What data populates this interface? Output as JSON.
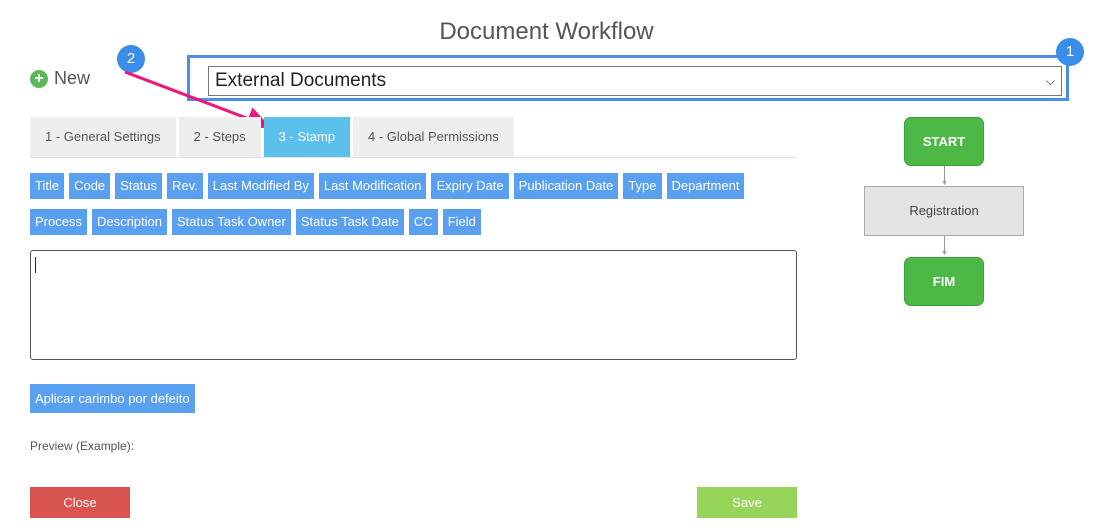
{
  "header": {
    "title": "Document Workflow"
  },
  "toolbar": {
    "new_label": "New"
  },
  "workflow_select": {
    "value": "External Documents"
  },
  "annotations": {
    "badge1": "1",
    "badge2": "2",
    "arrow_color": "#f0157a",
    "badge_color": "#3b8ee8"
  },
  "tabs": [
    {
      "label": "1 - General Settings",
      "active": false
    },
    {
      "label": "2 - Steps",
      "active": false
    },
    {
      "label": "3 - Stamp",
      "active": true
    },
    {
      "label": "4 - Global Permissions",
      "active": false
    }
  ],
  "field_tags_row1": [
    "Title",
    "Code",
    "Status",
    "Rev.",
    "Last Modified By",
    "Last Modification",
    "Expiry Date",
    "Publication Date",
    "Type",
    "Department"
  ],
  "field_tags_row2": [
    "Process",
    "Description",
    "Status Task Owner",
    "Status Task Date",
    "CC",
    "Field"
  ],
  "stamp_editor": {
    "value": ""
  },
  "actions": {
    "default_stamp_label": "Aplicar carimbo por defeito",
    "preview_label": "Preview (Example):",
    "close_label": "Close",
    "save_label": "Save"
  },
  "workflow_diagram": {
    "start": "START",
    "step": "Registration",
    "end": "FIM"
  },
  "colors": {
    "accent_blue": "#5aa0f0",
    "active_tab": "#5bc0eb",
    "close": "#d9534f",
    "save": "#96d45a",
    "node_green": "#4cb946"
  }
}
